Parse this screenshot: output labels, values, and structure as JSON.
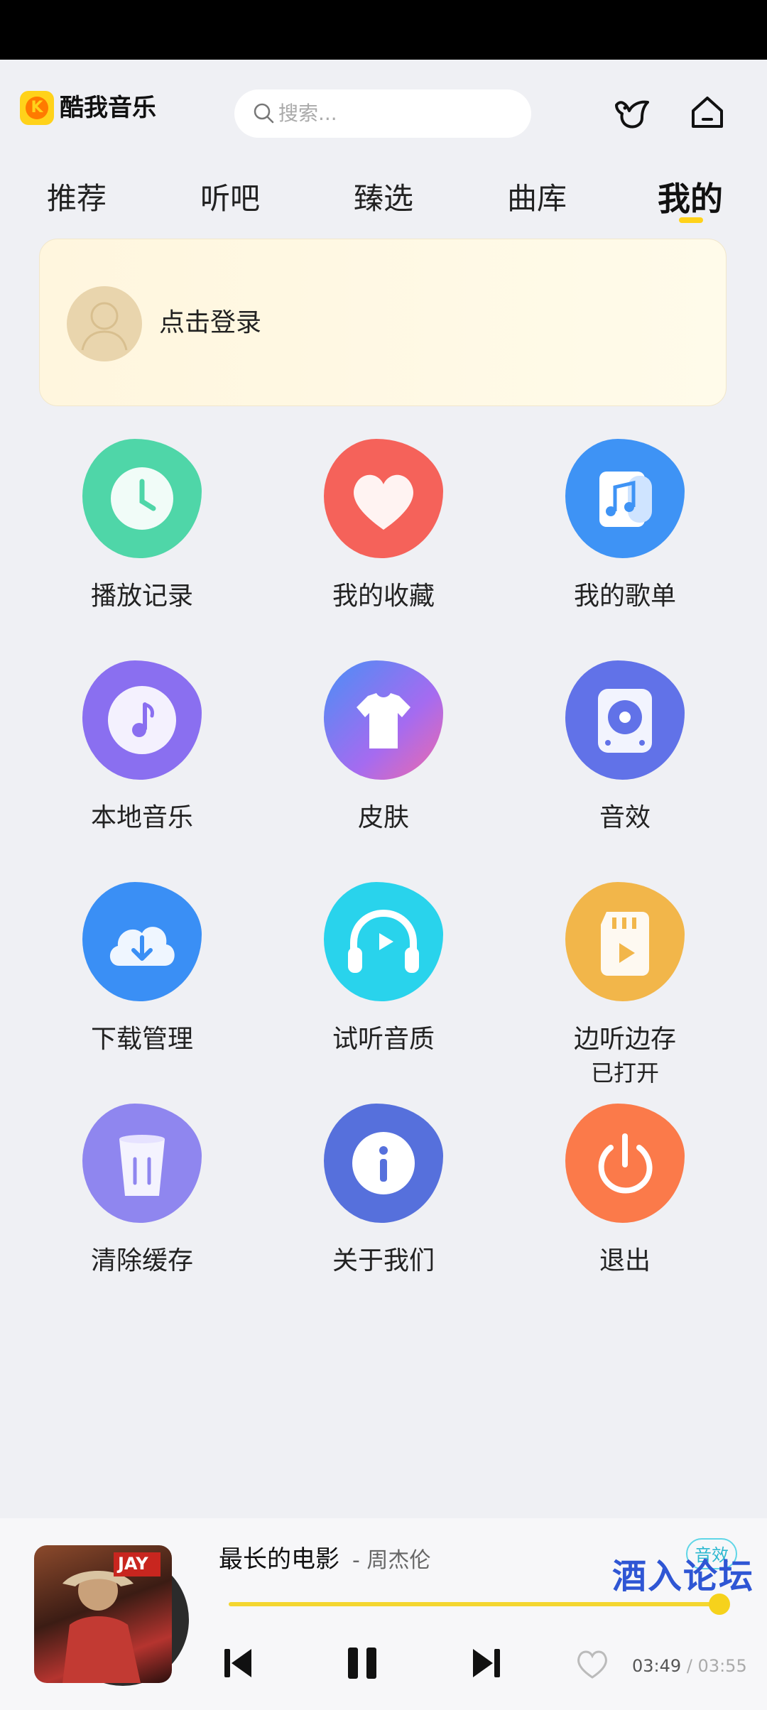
{
  "app": {
    "name": "酷我音乐",
    "logo_letter": "K"
  },
  "search": {
    "placeholder": "搜索..."
  },
  "tabs": [
    {
      "label": "推荐",
      "active": false
    },
    {
      "label": "听吧",
      "active": false
    },
    {
      "label": "臻选",
      "active": false
    },
    {
      "label": "曲库",
      "active": false
    },
    {
      "label": "我的",
      "active": true
    }
  ],
  "login": {
    "label": "点击登录"
  },
  "grid": [
    {
      "label": "播放记录",
      "icon": "clock-icon",
      "color": "#4fd6a8"
    },
    {
      "label": "我的收藏",
      "icon": "heart-icon",
      "color": "#f5625a"
    },
    {
      "label": "我的歌单",
      "icon": "music-note-icon",
      "color": "#3e93f5"
    },
    {
      "label": "本地音乐",
      "icon": "music-disc-icon",
      "color": "#8a6ff0"
    },
    {
      "label": "皮肤",
      "icon": "tshirt-icon",
      "color": "#6b7ef5"
    },
    {
      "label": "音效",
      "icon": "speaker-icon",
      "color": "#6172e8"
    },
    {
      "label": "下载管理",
      "icon": "cloud-download-icon",
      "color": "#3a8ff5"
    },
    {
      "label": "试听音质",
      "icon": "headphones-icon",
      "color": "#29d3ec"
    },
    {
      "label": "边听边存",
      "sub": "已打开",
      "icon": "sd-card-icon",
      "color": "#f2b64a"
    },
    {
      "label": "清除缓存",
      "icon": "trash-icon",
      "color": "#8f86ef"
    },
    {
      "label": "关于我们",
      "icon": "info-icon",
      "color": "#5670dc"
    },
    {
      "label": "退出",
      "icon": "power-icon",
      "color": "#fb7a4a"
    }
  ],
  "player": {
    "title": "最长的电影",
    "artist": "- 周杰伦",
    "fx_label": "音效",
    "cover_text": "JAY",
    "progress": 1.0,
    "current_time": "03:49",
    "separator": "/",
    "total_time": "03:55"
  },
  "watermark": "酒入论坛",
  "colors": {
    "accent": "#ffd21a",
    "background": "#eff0f4"
  }
}
